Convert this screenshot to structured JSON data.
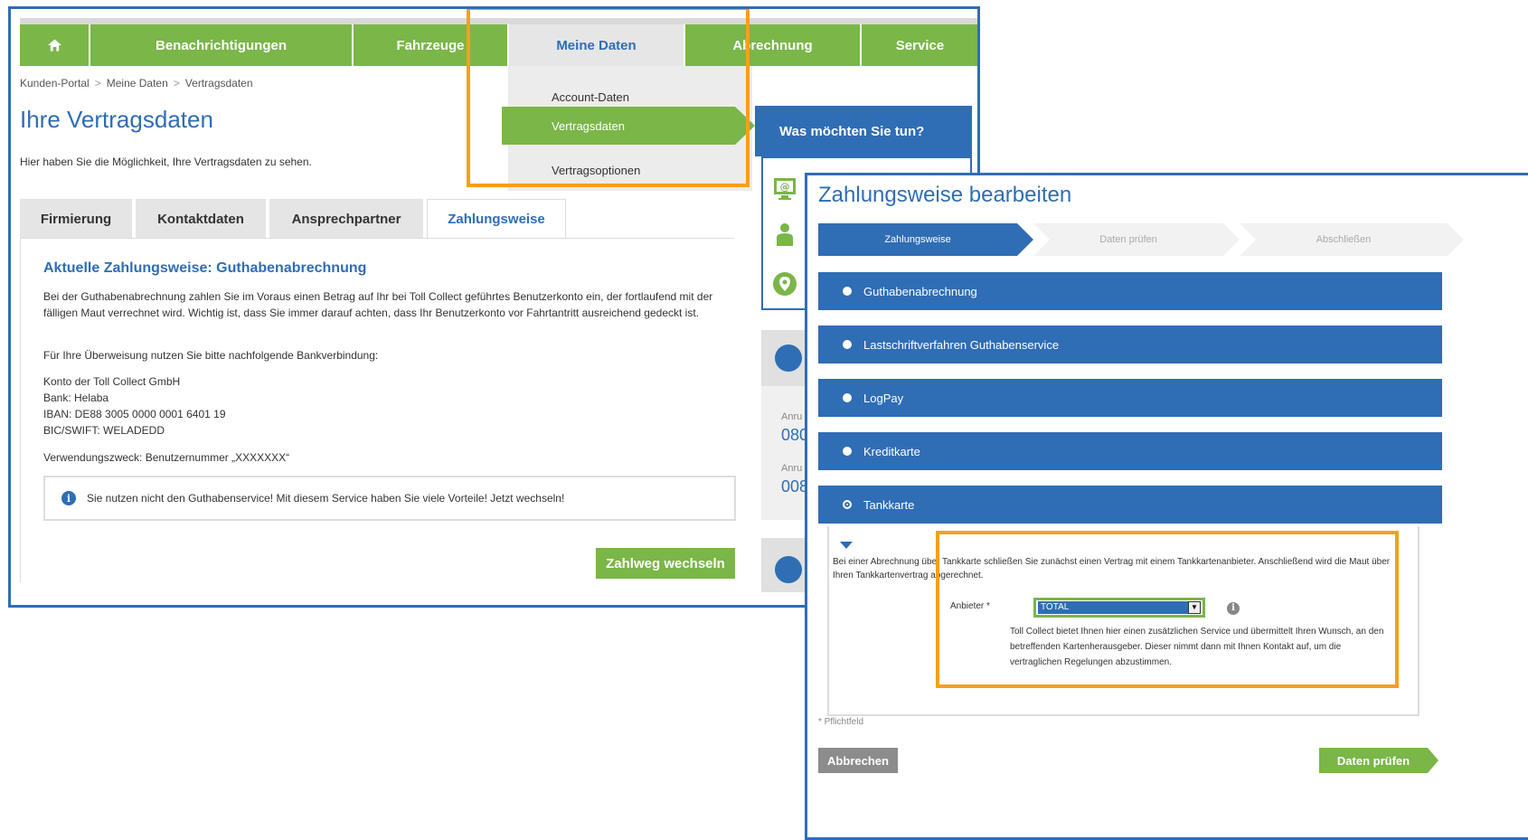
{
  "nav": {
    "items": [
      "Benachrichtigungen",
      "Fahrzeuge",
      "Meine Daten",
      "Abrechnung",
      "Service"
    ],
    "active": "Meine Daten"
  },
  "dropdown": {
    "items": [
      "Account-Daten",
      "Vertragsdaten",
      "Vertragsoptionen"
    ],
    "active": "Vertragsdaten"
  },
  "breadcrumb": [
    "Kunden-Portal",
    "Meine Daten",
    "Vertragsdaten"
  ],
  "page": {
    "title": "Ihre Vertragsdaten",
    "intro": "Hier haben Sie die Möglichkeit, Ihre Vertragsdaten zu sehen."
  },
  "tabs": [
    "Firmierung",
    "Kontaktdaten",
    "Ansprechpartner",
    "Zahlungsweise"
  ],
  "panel": {
    "heading": "Aktuelle Zahlungsweise: Guthabenabrechnung",
    "desc": "Bei der Guthabenabrechnung zahlen Sie im Voraus einen Betrag auf Ihr bei Toll Collect geführtes Benutzerkonto ein, der fortlaufend mit der fälligen Maut verrechnet wird. Wichtig ist, dass Sie immer darauf achten, dass Ihr Benutzerkonto vor Fahrtantritt ausreichend gedeckt ist.",
    "bank_intro": "Für Ihre Überweisung nutzen Sie bitte nachfolgende Bankverbindung:",
    "bank_lines": [
      "Konto der Toll Collect GmbH",
      "Bank: Helaba",
      "IBAN: DE88 3005 0000 0001 6401 19",
      "BIC/SWIFT: WELADEDD"
    ],
    "purpose": "Verwendungszweck: Benutzernummer „XXXXXXX“",
    "notice": "Sie nutzen nicht den Guthabenservice! Mit diesem Service haben Sie viele Vorteile! Jetzt wechseln!",
    "switch_button": "Zahlweg wechseln"
  },
  "side": {
    "heading": "Was möchten Sie tun?",
    "contact_label_1": "Anru",
    "contact_num_1": "080",
    "contact_label_2": "Anru",
    "contact_num_2": "008"
  },
  "dialog": {
    "title": "Zahlungsweise bearbeiten",
    "steps": [
      "Zahlungsweise",
      "Daten prüfen",
      "Abschließen"
    ],
    "options": [
      "Guthabenabrechnung",
      "Lastschriftverfahren Guthabenservice",
      "LogPay",
      "Kreditkarte",
      "Tankkarte"
    ],
    "selected_option": "Tankkarte",
    "tank_text": "Bei einer Abrechnung über Tankkarte schließen Sie zunächst einen Vertrag mit einem Tankkartenanbieter. Anschließend wird die Maut über Ihren Tankkartenvertrag abgerechnet.",
    "anbieter_label": "Anbieter *",
    "anbieter_value": "TOTAL",
    "anbieter_note": "Toll Collect bietet Ihnen hier einen zusätzlichen Service und übermittelt Ihren Wunsch, an den betreffenden Kartenherausgeber. Dieser nimmt dann mit Ihnen Kontakt auf, um die vertraglichen Regelungen abzustimmen.",
    "required_note": "* Pflichtfeld",
    "cancel_button": "Abbrechen",
    "next_button": "Daten prüfen"
  },
  "colors": {
    "brand_blue": "#2f6db5",
    "brand_green": "#7ab648",
    "highlight_orange": "#f5a01a"
  }
}
